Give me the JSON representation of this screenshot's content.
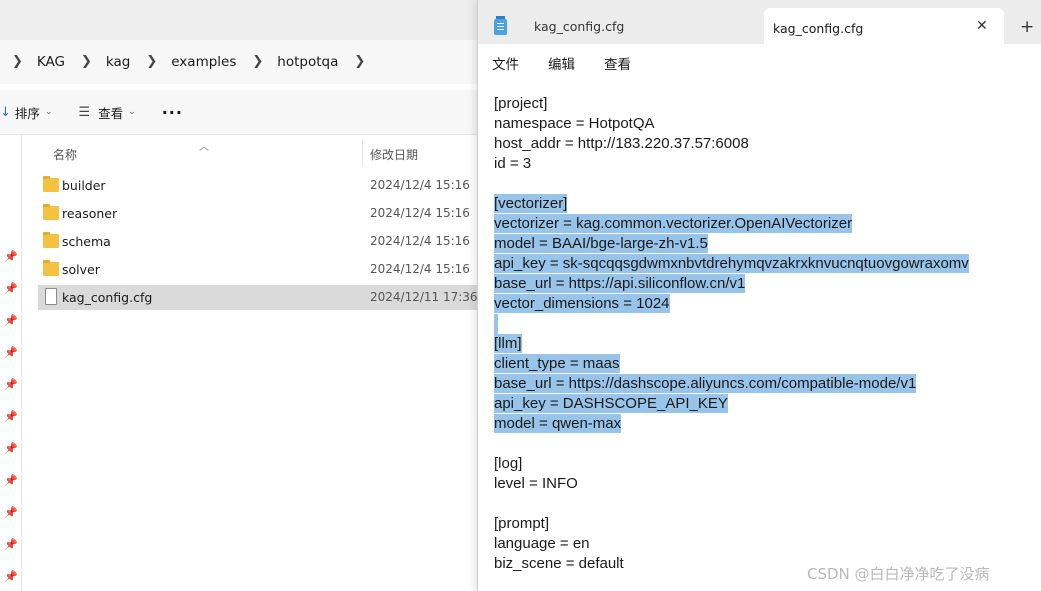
{
  "explorer": {
    "breadcrumb": [
      "KAG",
      "kag",
      "examples",
      "hotpotqa"
    ],
    "toolbar": {
      "sort_label": "排序",
      "view_label": "查看",
      "more_label": "···"
    },
    "columns": {
      "name": "名称",
      "modified": "修改日期"
    },
    "files": [
      {
        "name": "builder",
        "date": "2024/12/4 15:16",
        "type": "folder"
      },
      {
        "name": "reasoner",
        "date": "2024/12/4 15:16",
        "type": "folder"
      },
      {
        "name": "schema",
        "date": "2024/12/4 15:16",
        "type": "folder"
      },
      {
        "name": "solver",
        "date": "2024/12/4 15:16",
        "type": "folder"
      },
      {
        "name": "kag_config.cfg",
        "date": "2024/12/11 17:36",
        "type": "file",
        "selected": true
      }
    ]
  },
  "notepad": {
    "tabs": [
      {
        "label": "kag_config.cfg"
      },
      {
        "label": "kag_config.cfg",
        "active": true
      }
    ],
    "close_glyph": "✕",
    "new_tab_glyph": "+",
    "menu": [
      "文件",
      "编辑",
      "查看"
    ],
    "lines": [
      {
        "text": "[project]",
        "hl": false
      },
      {
        "text": "namespace = HotpotQA",
        "hl": false
      },
      {
        "text": "host_addr = http://183.220.37.57:6008",
        "hl": false
      },
      {
        "text": "id = 3",
        "hl": false
      },
      {
        "text": "",
        "hl": false
      },
      {
        "text": "[vectorizer]",
        "hl": true
      },
      {
        "text": "vectorizer = kag.common.vectorizer.OpenAIVectorizer",
        "hl": true
      },
      {
        "text": "model = BAAI/bge-large-zh-v1.5",
        "hl": true
      },
      {
        "text": "api_key = sk-sqcqqsgdwmxnbvtdrehymqvzakrxknvucnqtuovgowraxomv",
        "hl": true
      },
      {
        "text": "base_url = https://api.siliconflow.cn/v1",
        "hl": true
      },
      {
        "text": "vector_dimensions = 1024",
        "hl": true
      },
      {
        "text": "",
        "hl": true
      },
      {
        "text": "[llm]",
        "hl": true
      },
      {
        "text": "client_type = maas",
        "hl": true
      },
      {
        "text": "base_url = https://dashscope.aliyuncs.com/compatible-mode/v1",
        "hl": true
      },
      {
        "text": "api_key = DASHSCOPE_API_KEY",
        "hl": true
      },
      {
        "text": "model = qwen-max",
        "hl": true
      },
      {
        "text": "",
        "hl": false
      },
      {
        "text": "[log]",
        "hl": false
      },
      {
        "text": "level = INFO",
        "hl": false
      },
      {
        "text": "",
        "hl": false
      },
      {
        "text": "[prompt]",
        "hl": false
      },
      {
        "text": "language = en",
        "hl": false
      },
      {
        "text": "biz_scene = default",
        "hl": false
      }
    ]
  },
  "colors": {
    "selection": "#99c4ea",
    "folder": "#f4c242",
    "notepad_icon": "#4aa3df"
  },
  "watermark": "CSDN @白白净净吃了没病"
}
